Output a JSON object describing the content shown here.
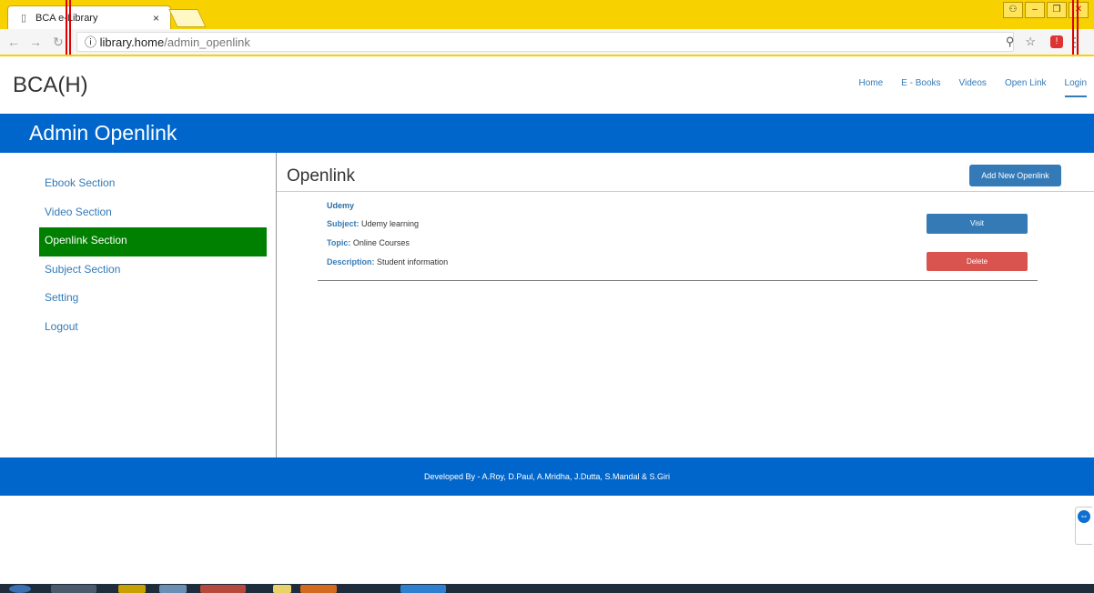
{
  "browser": {
    "tab_title": "BCA e-Library",
    "tab_close": "×",
    "url_host": "library.home",
    "url_path": "/admin_openlink",
    "info_icon": "ⓘ",
    "zoom_icon": "⚲",
    "star_icon": "☆"
  },
  "header": {
    "brand": "BCA(H)",
    "nav": [
      "Home",
      "E - Books",
      "Videos",
      "Open Link",
      "Login"
    ]
  },
  "banner": {
    "title": "Admin Openlink"
  },
  "sidebar": {
    "items": [
      "Ebook Section",
      "Video Section",
      "Openlink Section",
      "Subject Section",
      "Setting",
      "Logout"
    ],
    "active_index": 2
  },
  "main": {
    "title": "Openlink",
    "add_button": "Add New Openlink",
    "entry": {
      "name": "Udemy",
      "subject_label": "Subject:",
      "subject": "Udemy learning",
      "topic_label": "Topic:",
      "topic": "Online Courses",
      "description_label": "Description:",
      "description": "Student information",
      "visit_button": "Visit",
      "delete_button": "Delete"
    }
  },
  "footer": {
    "text": "Developed By - A.Roy, D.Paul, A.Mridha, J.Dutta, S.Mandal & S.Giri"
  },
  "colors": {
    "chrome_yellow": "#f7d200",
    "banner_blue": "#0066cc",
    "link_blue": "#337ab7",
    "active_green": "#008000",
    "delete_red": "#d9534f"
  }
}
